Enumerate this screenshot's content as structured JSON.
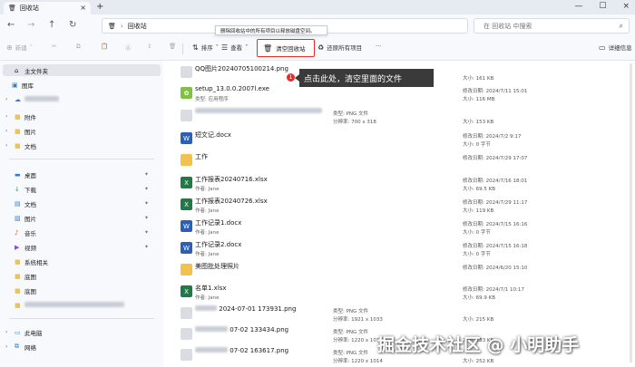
{
  "window": {
    "tab_title": "回收站"
  },
  "address": {
    "location": "回收站",
    "search_placeholder": "在 回收站 中搜索"
  },
  "tooltip": "删除回收站中的所有项目以释放磁盘空间。",
  "commands": {
    "new": "新建",
    "sort": "排序",
    "view": "查看",
    "empty_recycle_bin": "清空回收站",
    "restore_all": "还原所有项目",
    "more": "···",
    "details": "详细信息"
  },
  "sidebar": {
    "home": "主文件夹",
    "gallery": "图库",
    "attachments": "附件",
    "pictures": "图片",
    "docs": "文档",
    "desktop": "桌面",
    "downloads": "下载",
    "documents": "文档",
    "images": "图片",
    "music": "音乐",
    "videos": "视频",
    "system": "系统相关",
    "wallpaper": "底图",
    "wallpaper2": "底图",
    "this_pc": "此电脑",
    "network": "网络"
  },
  "files": [
    {
      "name": "QQ图片20240705100214.png",
      "sub": "",
      "type": "",
      "dim": "",
      "date": "",
      "size": "大小: 161 KB",
      "icon": "image-icon"
    },
    {
      "name": "setup_13.0.0.2007l.exe",
      "sub": "类型: 应用程序",
      "type": "",
      "dim": "",
      "date": "修改日期: 2024/7/11 15:01",
      "size": "大小: 116 MB",
      "icon": "app-icon"
    },
    {
      "name": "",
      "sub": "",
      "type": "类型: PNG 文件",
      "dim": "分辨率: 700 x 318",
      "date": "",
      "size": "大小: 153 KB",
      "icon": "image-icon"
    },
    {
      "name": "短文记.docx",
      "sub": "",
      "type": "",
      "dim": "",
      "date": "修改日期: 2024/7/2 9:17",
      "size": "大小: 0 字节",
      "icon": "word-icon"
    },
    {
      "name": "工作",
      "sub": "",
      "type": "",
      "dim": "",
      "date": "修改日期: 2024/7/29 17:07",
      "size": "",
      "icon": "folder-icon"
    },
    {
      "name": "工作报表20240716.xlsx",
      "sub": "作者: Jane",
      "type": "",
      "dim": "",
      "date": "修改日期: 2024/7/16 18:01",
      "size": "大小: 69.5 KB",
      "icon": "excel-icon"
    },
    {
      "name": "工作报表20240726.xlsx",
      "sub": "作者: Jane",
      "type": "",
      "dim": "",
      "date": "修改日期: 2024/7/29 11:17",
      "size": "大小: 119 KB",
      "icon": "excel-icon"
    },
    {
      "name": "工作记录1.docx",
      "sub": "作者: Jane",
      "type": "",
      "dim": "",
      "date": "修改日期: 2024/7/15 16:16",
      "size": "大小: 0 字节",
      "icon": "word-icon"
    },
    {
      "name": "工作记录2.docx",
      "sub": "作者: Jane",
      "type": "",
      "dim": "",
      "date": "修改日期: 2024/7/15 16:18",
      "size": "大小: 0 字节",
      "icon": "word-icon"
    },
    {
      "name": "美图批处理照片",
      "sub": "",
      "type": "",
      "dim": "",
      "date": "修改日期: 2024/6/20 15:10",
      "size": "",
      "icon": "folder-icon"
    },
    {
      "name": "名单1.xlsx",
      "sub": "作者: Jane",
      "type": "",
      "dim": "",
      "date": "修改日期: 2024/7/1 10:17",
      "size": "大小: 69.9 KB",
      "icon": "excel-icon"
    },
    {
      "name": "2024-07-01 173931.png",
      "sub": "",
      "type": "类型: PNG 文件",
      "dim": "分辨率: 1921 x 1033",
      "date": "",
      "size": "大小: 215 KB",
      "icon": "image-icon"
    },
    {
      "name": "07-02 133434.png",
      "sub": "",
      "type": "类型: PNG 文件",
      "dim": "分辨率: 1220 x 1015",
      "date": "",
      "size": "大小: 183 KB",
      "icon": "image-icon"
    },
    {
      "name": "07-02 163617.png",
      "sub": "",
      "type": "类型: PNG 文件",
      "dim": "分辨率: 1220 x 1014",
      "date": "",
      "size": "大小: 252 KB",
      "icon": "image-icon"
    }
  ],
  "annotation": {
    "badge": "1",
    "text": "点击此处，清空里面的文件"
  },
  "watermark": "掘金技术社区 @ 小明助手",
  "colors": {
    "highlight": "#e0302a",
    "folder": "#f2c14e",
    "word": "#2b5fb8",
    "excel": "#1f7a45"
  }
}
